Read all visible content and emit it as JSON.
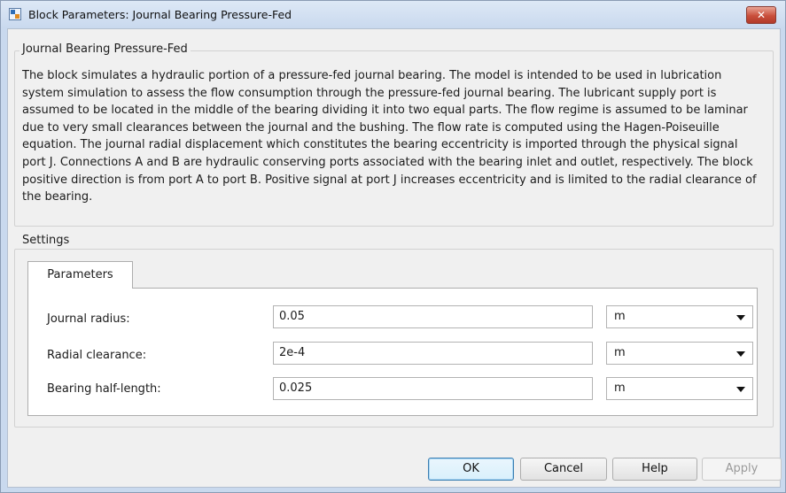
{
  "window": {
    "title": "Block Parameters: Journal Bearing Pressure-Fed",
    "close_glyph": "✕"
  },
  "description_group": {
    "legend": "Journal Bearing Pressure-Fed",
    "text": "The block simulates a hydraulic portion of a pressure-fed journal bearing. The model is intended to be used in lubrication system simulation to assess the flow consumption through the pressure-fed journal bearing. The lubricant supply port is assumed to be located in the middle of the bearing dividing it into two equal parts. The flow regime is assumed to be laminar due to very small clearances between the journal and the bushing. The flow rate is computed using the Hagen-Poiseuille equation. The journal radial displacement which constitutes the bearing eccentricity is imported through the physical signal port J. Connections A and B are hydraulic conserving ports associated with the bearing inlet and outlet, respectively. The block positive direction is from port A to port B. Positive signal at port J increases eccentricity and is limited to the radial clearance of the bearing."
  },
  "settings": {
    "legend": "Settings",
    "tab_label": "Parameters",
    "params": [
      {
        "label": "Journal radius:",
        "value": "0.05",
        "unit": "m"
      },
      {
        "label": "Radial clearance:",
        "value": "2e-4",
        "unit": "m"
      },
      {
        "label": "Bearing half-length:",
        "value": "0.025",
        "unit": "m"
      }
    ]
  },
  "buttons": {
    "ok": "OK",
    "cancel": "Cancel",
    "help": "Help",
    "apply": "Apply"
  }
}
